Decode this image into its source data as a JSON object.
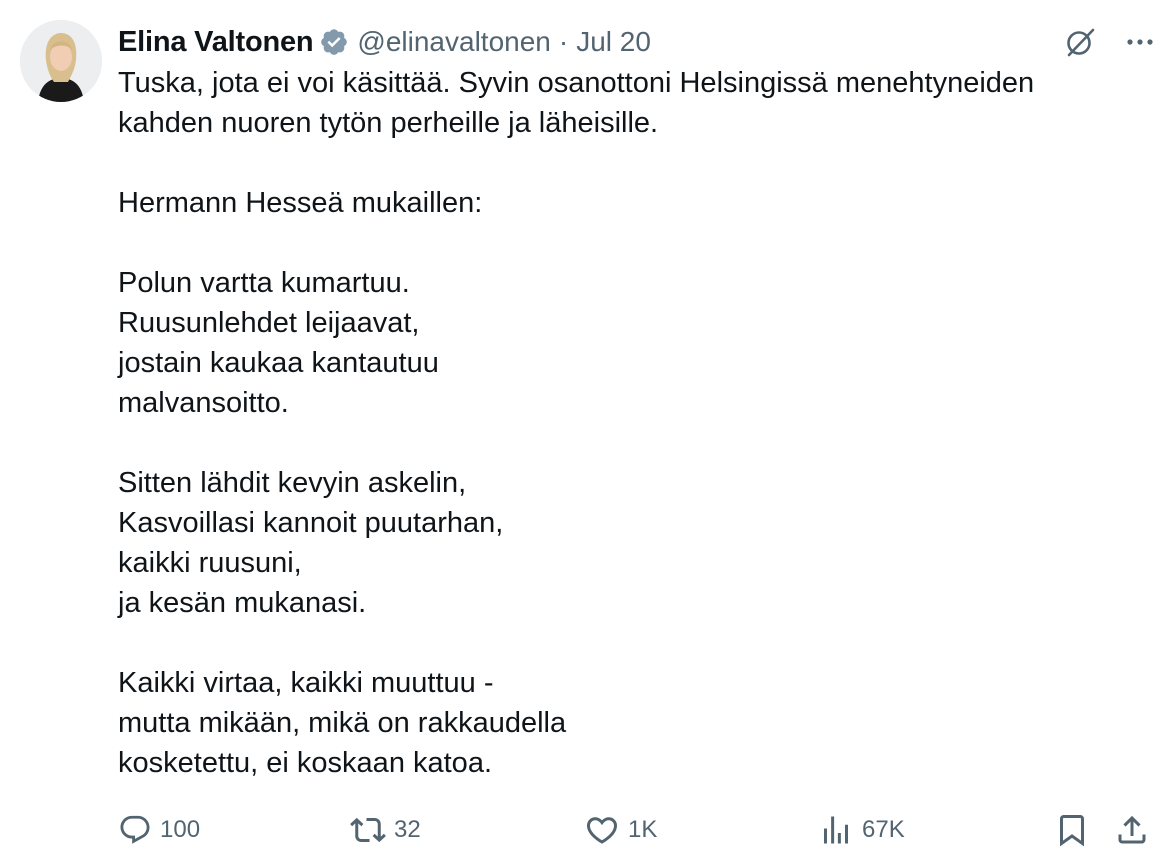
{
  "author": {
    "display_name": "Elina Valtonen",
    "verified_icon": "verified-badge-icon",
    "handle": "@elinavaltonen",
    "separator": "·",
    "date": "Jul 20"
  },
  "top_actions": {
    "grok_icon": "grok-icon",
    "more_icon": "more-options-icon"
  },
  "tweet": {
    "paragraphs": [
      {
        "lines": [
          "Tuska, jota ei voi käsittää. Syvin osanottoni Helsingissä menehtyneiden",
          "kahden nuoren tytön perheille ja läheisille."
        ]
      },
      {
        "lines": [
          "Hermann Hesseä mukaillen:"
        ]
      },
      {
        "lines": [
          "Polun vartta kumartuu.",
          "Ruusunlehdet leijaavat,",
          "jostain kaukaa kantautuu",
          "malvansoitto."
        ]
      },
      {
        "lines": [
          "Sitten lähdit kevyin askelin,",
          "Kasvoillasi kannoit puutarhan,",
          "kaikki ruusuni,",
          "ja kesän mukanasi."
        ]
      },
      {
        "lines": [
          "Kaikki virtaa, kaikki muuttuu -",
          "mutta mikään, mikä on rakkaudella",
          "kosketettu, ei koskaan katoa."
        ]
      }
    ]
  },
  "actions": {
    "replies": "100",
    "reposts": "32",
    "likes": "1K",
    "views": "67K"
  },
  "colors": {
    "text": "#0f1419",
    "secondary": "#536471",
    "verified_badge": "#829aab"
  }
}
